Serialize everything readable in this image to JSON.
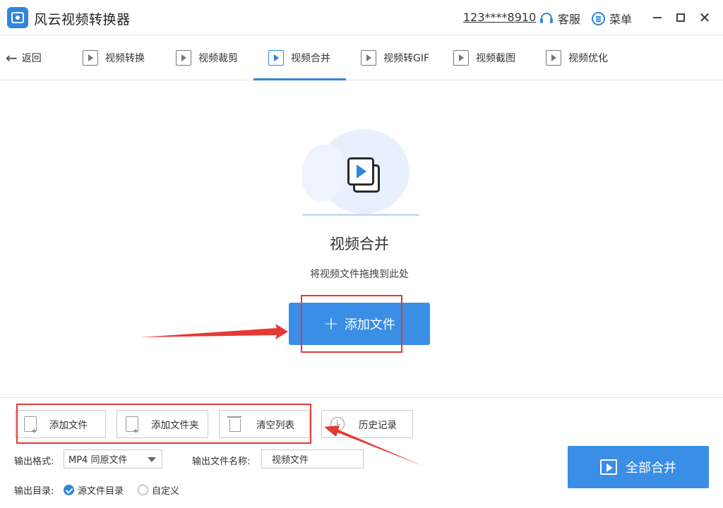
{
  "app": {
    "title": "风云视频转换器",
    "account": "123****8910",
    "service_label": "客服",
    "menu_label": "菜单"
  },
  "nav": {
    "back_label": "返回",
    "tabs": [
      {
        "label": "视频转换",
        "icon": "video-convert-icon",
        "active": false
      },
      {
        "label": "视频裁剪",
        "icon": "video-crop-icon",
        "active": false
      },
      {
        "label": "视频合并",
        "icon": "video-merge-icon",
        "active": true
      },
      {
        "label": "视频转GIF",
        "icon": "gif-icon",
        "active": false
      },
      {
        "label": "视频截图",
        "icon": "screenshot-icon",
        "active": false
      },
      {
        "label": "视频优化",
        "icon": "optimize-icon",
        "active": false
      }
    ]
  },
  "drop_area": {
    "title": "视频合并",
    "hint": "将视频文件拖拽到此处",
    "add_button": "添加文件"
  },
  "toolbar": {
    "add_file": "添加文件",
    "add_folder": "添加文件夹",
    "clear_list": "清空列表",
    "history": "历史记录"
  },
  "output": {
    "format_label": "输出格式:",
    "format_value": "MP4 同原文件",
    "name_label": "输出文件名称:",
    "name_value": "视频文件",
    "dir_label": "输出目录:",
    "dir_options": [
      {
        "label": "源文件目录",
        "selected": true
      },
      {
        "label": "自定义",
        "selected": false
      }
    ]
  },
  "merge_all_label": "全部合并",
  "colors": {
    "accent": "#3a8ee6",
    "highlight": "#e53935"
  }
}
